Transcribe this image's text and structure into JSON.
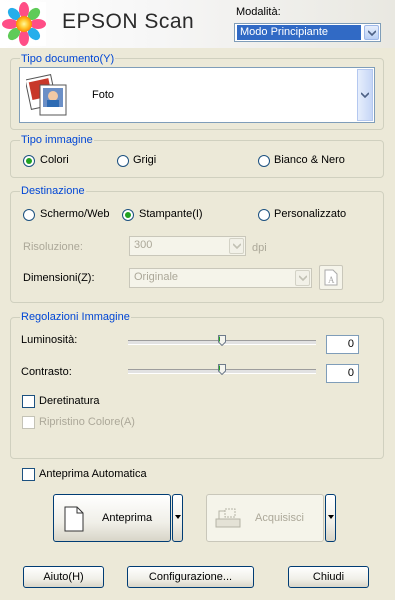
{
  "header": {
    "app_title": "EPSON Scan",
    "mode_label": "Modalità:",
    "mode_value": "Modo Principiante"
  },
  "document_type": {
    "title": "Tipo documento(Y)",
    "value": "Foto"
  },
  "image_type": {
    "title": "Tipo immagine",
    "options": [
      "Colori",
      "Grigi",
      "Bianco & Nero"
    ],
    "selected": "Colori"
  },
  "destination": {
    "title": "Destinazione",
    "options": [
      "Schermo/Web",
      "Stampante(I)",
      "Personalizzato"
    ],
    "selected": "Stampante(I)",
    "resolution_label": "Risoluzione:",
    "resolution_value": "300",
    "resolution_unit": "dpi",
    "size_label": "Dimensioni(Z):",
    "size_value": "Originale"
  },
  "adjustments": {
    "title": "Regolazioni Immagine",
    "brightness_label": "Luminosità:",
    "brightness_value": "0",
    "contrast_label": "Contrasto:",
    "contrast_value": "0",
    "descreening_label": "Deretinatura",
    "color_restoration_label": "Ripristino Colore(A)"
  },
  "auto_preview_label": "Anteprima Automatica",
  "buttons": {
    "preview": "Anteprima",
    "scan": "Acquisisci",
    "help": "Aiuto(H)",
    "config": "Configurazione...",
    "close": "Chiudi"
  },
  "colors": {
    "accent_blue": "#316ac5",
    "group_title": "#0046d5",
    "dialog_bg": "#ece9d8"
  }
}
